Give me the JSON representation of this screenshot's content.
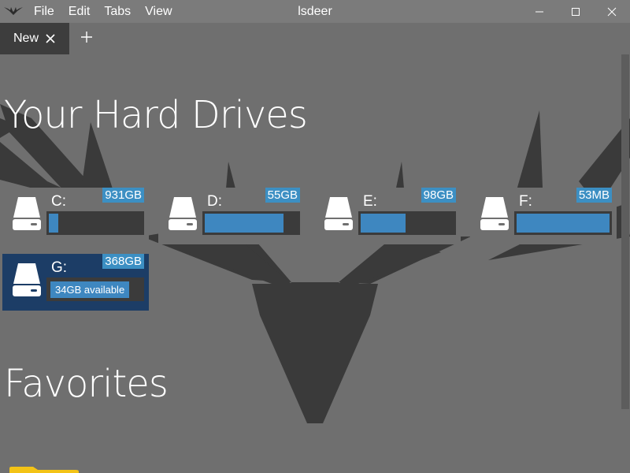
{
  "window": {
    "title": "lsdeer"
  },
  "menu": {
    "items": [
      "File",
      "Edit",
      "Tabs",
      "View"
    ]
  },
  "tabs": [
    {
      "label": "New"
    }
  ],
  "headings": {
    "drives": "Your Hard Drives",
    "favorites": "Favorites"
  },
  "drives": [
    {
      "letter": "C:",
      "size": "931GB",
      "used_fraction": 0.1
    },
    {
      "letter": "D:",
      "size": "55GB",
      "used_fraction": 0.85
    },
    {
      "letter": "E:",
      "size": "98GB",
      "used_fraction": 0.48
    },
    {
      "letter": "F:",
      "size": "53MB",
      "used_fraction": 1.0
    },
    {
      "letter": "G:",
      "size": "368GB",
      "available": "34GB available",
      "selected": true
    }
  ],
  "colors": {
    "accent": "#3c8fc3",
    "selection": "#1c3d66",
    "background": "#6f6f6f",
    "deer": "#3a3a3a"
  },
  "icons": {
    "logo": "antler-logo-icon",
    "close": "close-icon",
    "add": "plus-icon",
    "drive": "hard-drive-icon",
    "folder": "folder-icon"
  }
}
